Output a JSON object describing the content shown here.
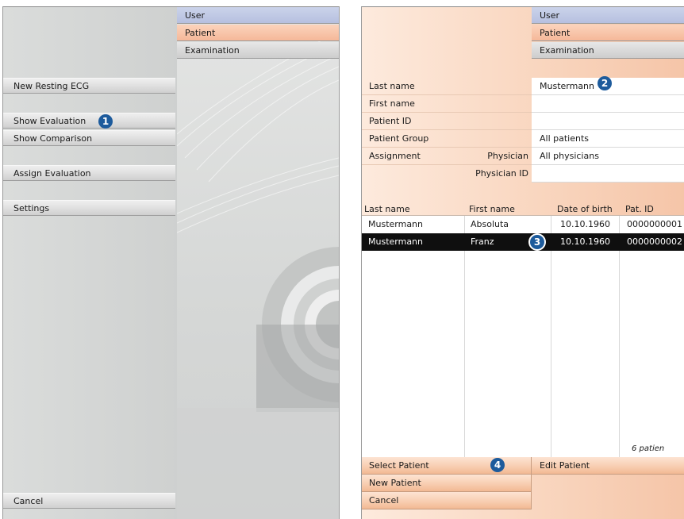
{
  "left_panel": {
    "tabs": {
      "user": "User",
      "patient": "Patient",
      "examination": "Examination"
    },
    "buttons": {
      "new_resting_ecg": "New Resting ECG",
      "show_evaluation": "Show Evaluation",
      "show_comparison": "Show Comparison",
      "assign_evaluation": "Assign Evaluation",
      "settings": "Settings",
      "cancel": "Cancel"
    },
    "callout": "1"
  },
  "right_panel": {
    "tabs": {
      "user": "User",
      "patient": "Patient",
      "examination": "Examination"
    },
    "search_form": {
      "last_name": {
        "label": "Last name",
        "value": "Mustermann"
      },
      "first_name": {
        "label": "First name",
        "value": ""
      },
      "patient_id": {
        "label": "Patient ID",
        "value": ""
      },
      "patient_group": {
        "label": "Patient Group",
        "value": "All patients"
      },
      "assignment": {
        "label": "Assignment",
        "sub_label": "Physician",
        "value": "All physicians"
      },
      "physician_id": {
        "label": "Physician ID",
        "value": ""
      }
    },
    "table": {
      "headers": {
        "last_name": "Last name",
        "first_name": "First name",
        "date_of_birth": "Date of birth",
        "pat_id": "Pat. ID"
      },
      "rows": [
        {
          "last_name": "Mustermann",
          "first_name": "Absoluta",
          "date_of_birth": "10.10.1960",
          "pat_id": "0000000001",
          "selected": false
        },
        {
          "last_name": "Mustermann",
          "first_name": "Franz",
          "date_of_birth": "10.10.1960",
          "pat_id": "0000000002",
          "selected": true
        }
      ]
    },
    "status": "6 patien",
    "buttons": {
      "select_patient": "Select Patient",
      "edit_patient": "Edit Patient",
      "new_patient": "New Patient",
      "cancel": "Cancel"
    },
    "callouts": {
      "search": "2",
      "row": "3",
      "select": "4"
    }
  },
  "colors": {
    "badge": "#1d5b9c",
    "tab_user": "#b6c0e0",
    "tab_patient": "#f5b899",
    "selected_row": "#0f0f0f"
  }
}
